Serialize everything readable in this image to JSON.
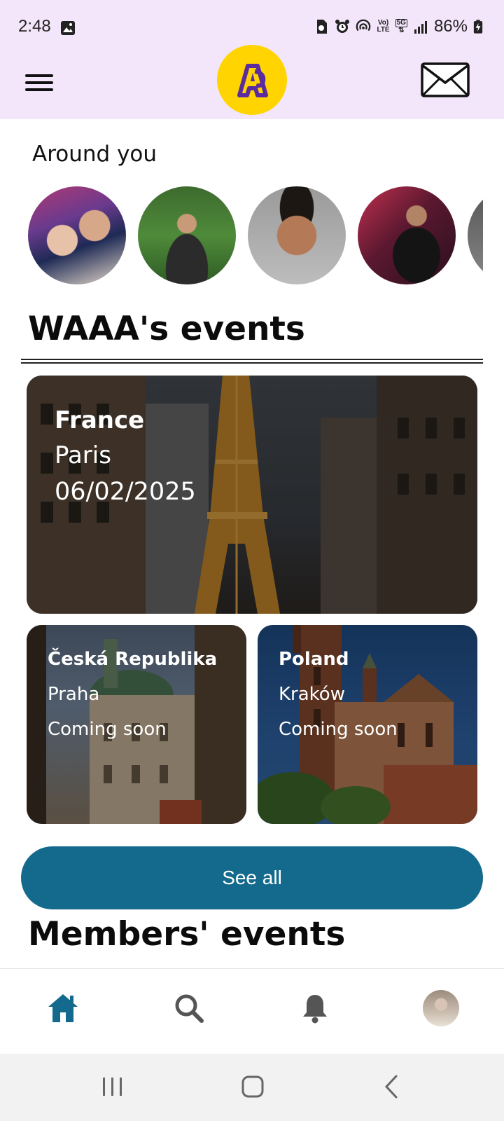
{
  "status_bar": {
    "time": "2:48",
    "battery": "86%",
    "network_top": "Vo)",
    "network_bottom": "LTE",
    "fiveg": "5G"
  },
  "app_bar": {
    "logo_letter": "A",
    "brand_color": "#ffd400",
    "accent_color": "#5a2ca0"
  },
  "around_you": {
    "title": "Around you"
  },
  "waaa_events": {
    "title": "WAAA's events",
    "featured": {
      "country": "France",
      "city": "Paris",
      "date": "06/02/2025"
    },
    "cards": [
      {
        "country": "Česká Republika",
        "city": "Praha",
        "status": "Coming soon"
      },
      {
        "country": "Poland",
        "city": "Kraków",
        "status": "Coming soon"
      }
    ],
    "see_all_label": "See all",
    "see_all_color": "#146a8d"
  },
  "members_events": {
    "title": "Members' events"
  },
  "bottom_nav": {
    "items": [
      {
        "icon": "home-icon",
        "active": true
      },
      {
        "icon": "search-icon",
        "active": false
      },
      {
        "icon": "bell-icon",
        "active": false
      },
      {
        "icon": "profile-avatar",
        "active": false
      }
    ],
    "active_color": "#146a8d"
  }
}
